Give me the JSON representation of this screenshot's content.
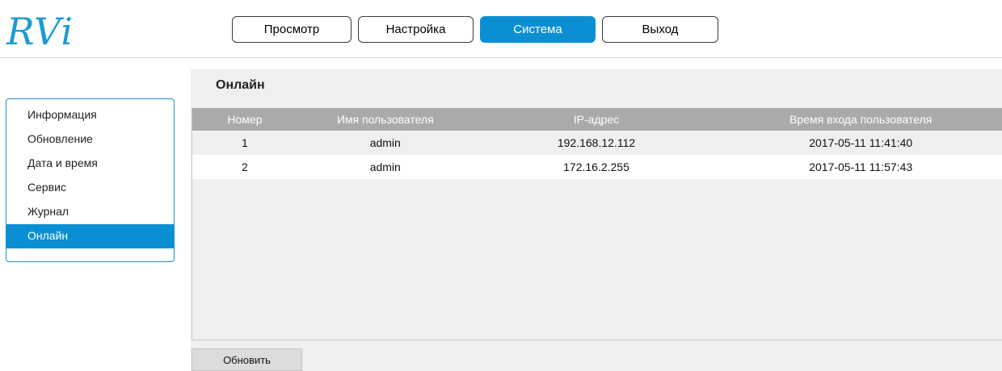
{
  "logo": {
    "text": "RVi"
  },
  "top_nav": {
    "items": [
      {
        "label": "Просмотр",
        "active": false
      },
      {
        "label": "Настройка",
        "active": false
      },
      {
        "label": "Система",
        "active": true
      },
      {
        "label": "Выход",
        "active": false
      }
    ]
  },
  "sidebar": {
    "items": [
      {
        "label": "Информация"
      },
      {
        "label": "Обновление"
      },
      {
        "label": "Дата и время"
      },
      {
        "label": "Сервис"
      },
      {
        "label": "Журнал"
      },
      {
        "label": "Онлайн",
        "active": true
      }
    ]
  },
  "main": {
    "title": "Онлайн",
    "table": {
      "headers": [
        "Номер",
        "Имя пользователя",
        "IP-адрес",
        "Время входа пользователя"
      ],
      "rows": [
        [
          "1",
          "admin",
          "192.168.12.112",
          "2017-05-11 11:41:40"
        ],
        [
          "2",
          "admin",
          "172.16.2.255",
          "2017-05-11 11:57:43"
        ]
      ]
    },
    "refresh_label": "Обновить"
  },
  "colors": {
    "accent": "#0b8fd4",
    "header_bg": "#aaaaaa",
    "panel_bg": "#efefef"
  }
}
